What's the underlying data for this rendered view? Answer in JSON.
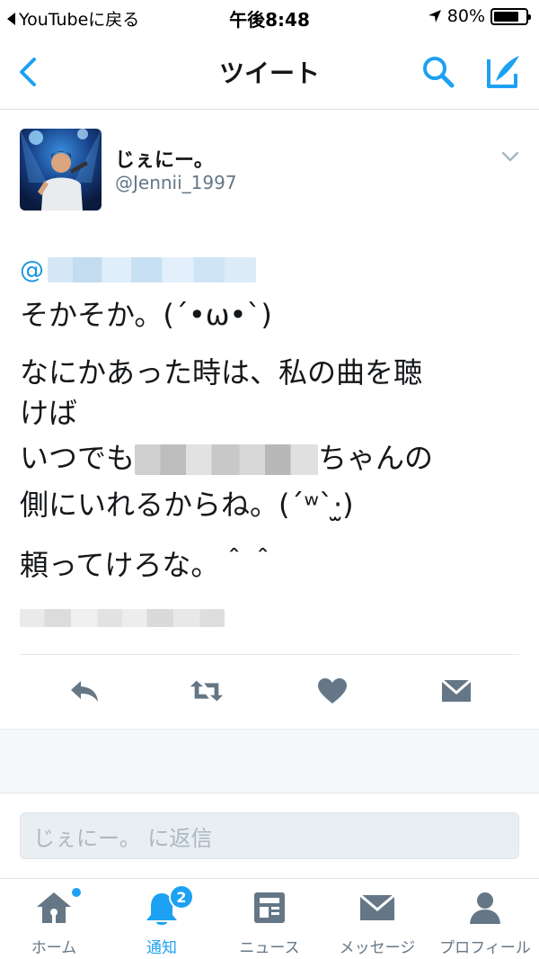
{
  "status_bar": {
    "back_app": "YouTubeに戻る",
    "time": "午後8:48",
    "battery": "80%",
    "battery_level": 0.8
  },
  "nav": {
    "title": "ツイート",
    "back_icon": "chevron-left-icon",
    "search_icon": "search-icon",
    "compose_icon": "compose-icon",
    "accent_color": "#1da1f2"
  },
  "tweet": {
    "display_name": "じぇにー。",
    "handle": "@Jennii_1997",
    "mention_prefix": "@",
    "lines": {
      "l1": "そかそか。(´•ω•`)",
      "l2": "なにかあった時は、私の曲を聴",
      "l3": "けば",
      "l4a": "いつでも",
      "l4b": "ちゃんの",
      "l5": "側にいれるからね。(´ʷ`‧̫)",
      "l6": "頼ってけろな。＾＾"
    },
    "actions": [
      "reply-icon",
      "retweet-icon",
      "like-icon",
      "direct-message-icon"
    ]
  },
  "reply": {
    "placeholder": "じぇにー。 に返信"
  },
  "tab_bar": {
    "items": [
      {
        "label": "ホーム",
        "icon": "home-icon"
      },
      {
        "label": "通知",
        "icon": "notification-bell-icon",
        "badge": "2"
      },
      {
        "label": "ニュース",
        "icon": "news-icon"
      },
      {
        "label": "メッセージ",
        "icon": "message-icon"
      },
      {
        "label": "プロフィール",
        "icon": "profile-icon"
      }
    ]
  }
}
